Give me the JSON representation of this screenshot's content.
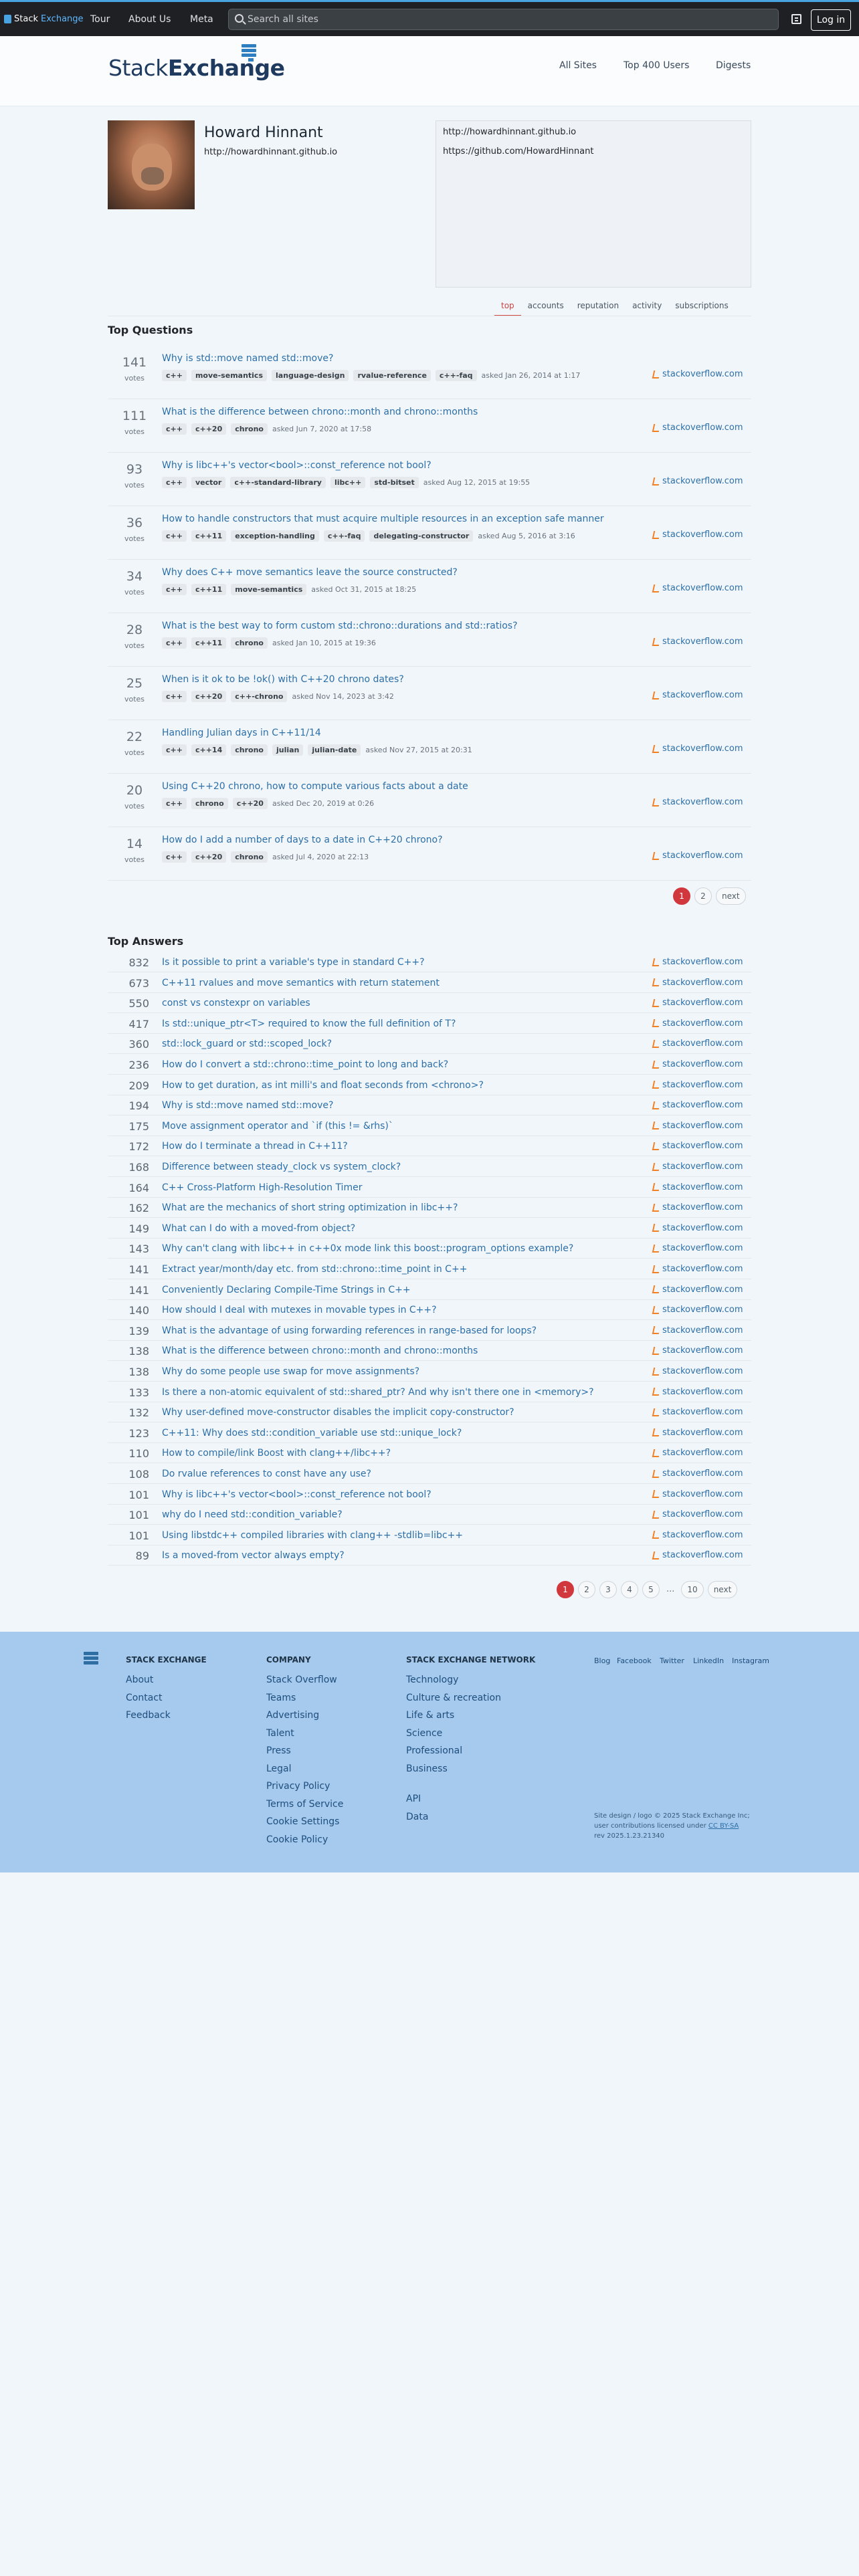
{
  "topbar": {
    "brand_stack": "Stack",
    "brand_exchange": "Exchange",
    "nav": [
      "Tour",
      "About Us",
      "Meta"
    ],
    "search_placeholder": "Search all sites",
    "login": "Log in"
  },
  "header": {
    "logo_stack": "Stack",
    "logo_exchange": "Exchange",
    "nav": [
      "All Sites",
      "Top 400 Users",
      "Digests"
    ]
  },
  "profile": {
    "name": "Howard Hinnant",
    "url": "http://howardhinnant.github.io",
    "about": [
      "http://howardhinnant.github.io",
      "https://github.com/HowardHinnant"
    ],
    "tabs": [
      "top",
      "accounts",
      "reputation",
      "activity",
      "subscriptions"
    ],
    "active_tab": "top"
  },
  "top_questions": {
    "heading": "Top Questions",
    "votes_label": "votes",
    "items": [
      {
        "votes": "141",
        "title": "Why is std::move named std::move?",
        "tags": [
          "c++",
          "move-semantics",
          "language-design",
          "rvalue-reference",
          "c++-faq"
        ],
        "asked": "asked Jan 26, 2014 at 1:17",
        "site": "stackoverflow.com"
      },
      {
        "votes": "111",
        "title": "What is the difference between chrono::month and chrono::months",
        "tags": [
          "c++",
          "c++20",
          "chrono"
        ],
        "asked": "asked Jun 7, 2020 at 17:58",
        "site": "stackoverflow.com"
      },
      {
        "votes": "93",
        "title": "Why is libc++'s vector<bool>::const_reference not bool?",
        "tags": [
          "c++",
          "vector",
          "c++-standard-library",
          "libc++",
          "std-bitset"
        ],
        "asked": "asked Aug 12, 2015 at 19:55",
        "site": "stackoverflow.com"
      },
      {
        "votes": "36",
        "title": "How to handle constructors that must acquire multiple resources in an exception safe manner",
        "tags": [
          "c++",
          "c++11",
          "exception-handling",
          "c++-faq",
          "delegating-constructor"
        ],
        "asked": "asked Aug 5, 2016 at 3:16",
        "site": "stackoverflow.com"
      },
      {
        "votes": "34",
        "title": "Why does C++ move semantics leave the source constructed?",
        "tags": [
          "c++",
          "c++11",
          "move-semantics"
        ],
        "asked": "asked Oct 31, 2015 at 18:25",
        "site": "stackoverflow.com"
      },
      {
        "votes": "28",
        "title": "What is the best way to form custom std::chrono::durations and std::ratios?",
        "tags": [
          "c++",
          "c++11",
          "chrono"
        ],
        "asked": "asked Jan 10, 2015 at 19:36",
        "site": "stackoverflow.com"
      },
      {
        "votes": "25",
        "title": "When is it ok to be !ok() with C++20 chrono dates?",
        "tags": [
          "c++",
          "c++20",
          "c++-chrono"
        ],
        "asked": "asked Nov 14, 2023 at 3:42",
        "site": "stackoverflow.com"
      },
      {
        "votes": "22",
        "title": "Handling Julian days in C++11/14",
        "tags": [
          "c++",
          "c++14",
          "chrono",
          "julian",
          "julian-date"
        ],
        "asked": "asked Nov 27, 2015 at 20:31",
        "site": "stackoverflow.com"
      },
      {
        "votes": "20",
        "title": "Using C++20 chrono, how to compute various facts about a date",
        "tags": [
          "c++",
          "chrono",
          "c++20"
        ],
        "asked": "asked Dec 20, 2019 at 0:26",
        "site": "stackoverflow.com"
      },
      {
        "votes": "14",
        "title": "How do I add a number of days to a date in C++20 chrono?",
        "tags": [
          "c++",
          "c++20",
          "chrono"
        ],
        "asked": "asked Jul 4, 2020 at 22:13",
        "site": "stackoverflow.com"
      }
    ],
    "pages": [
      "1",
      "2"
    ],
    "next": "next"
  },
  "top_answers": {
    "heading": "Top Answers",
    "items": [
      {
        "votes": "832",
        "title": "Is it possible to print a variable's type in standard C++?",
        "site": "stackoverflow.com"
      },
      {
        "votes": "673",
        "title": "C++11 rvalues and move semantics with return statement",
        "site": "stackoverflow.com"
      },
      {
        "votes": "550",
        "title": "const vs constexpr on variables",
        "site": "stackoverflow.com"
      },
      {
        "votes": "417",
        "title": "Is std::unique_ptr<T> required to know the full definition of T?",
        "site": "stackoverflow.com"
      },
      {
        "votes": "360",
        "title": "std::lock_guard or std::scoped_lock?",
        "site": "stackoverflow.com"
      },
      {
        "votes": "236",
        "title": "How do I convert a std::chrono::time_point to long and back?",
        "site": "stackoverflow.com"
      },
      {
        "votes": "209",
        "title": "How to get duration, as int milli's and float seconds from <chrono>?",
        "site": "stackoverflow.com"
      },
      {
        "votes": "194",
        "title": "Why is std::move named std::move?",
        "site": "stackoverflow.com"
      },
      {
        "votes": "175",
        "title": "Move assignment operator and `if (this != &rhs)`",
        "site": "stackoverflow.com"
      },
      {
        "votes": "172",
        "title": "How do I terminate a thread in C++11?",
        "site": "stackoverflow.com"
      },
      {
        "votes": "168",
        "title": "Difference between steady_clock vs system_clock?",
        "site": "stackoverflow.com"
      },
      {
        "votes": "164",
        "title": "C++ Cross-Platform High-Resolution Timer",
        "site": "stackoverflow.com"
      },
      {
        "votes": "162",
        "title": "What are the mechanics of short string optimization in libc++?",
        "site": "stackoverflow.com"
      },
      {
        "votes": "149",
        "title": "What can I do with a moved-from object?",
        "site": "stackoverflow.com"
      },
      {
        "votes": "143",
        "title": "Why can't clang with libc++ in c++0x mode link this boost::program_options example?",
        "site": "stackoverflow.com"
      },
      {
        "votes": "141",
        "title": "Extract year/month/day etc. from std::chrono::time_point in C++",
        "site": "stackoverflow.com"
      },
      {
        "votes": "141",
        "title": "Conveniently Declaring Compile-Time Strings in C++",
        "site": "stackoverflow.com"
      },
      {
        "votes": "140",
        "title": "How should I deal with mutexes in movable types in C++?",
        "site": "stackoverflow.com"
      },
      {
        "votes": "139",
        "title": "What is the advantage of using forwarding references in range-based for loops?",
        "site": "stackoverflow.com"
      },
      {
        "votes": "138",
        "title": "What is the difference between chrono::month and chrono::months",
        "site": "stackoverflow.com"
      },
      {
        "votes": "138",
        "title": "Why do some people use swap for move assignments?",
        "site": "stackoverflow.com"
      },
      {
        "votes": "133",
        "title": "Is there a non-atomic equivalent of std::shared_ptr? And why isn't there one in <memory>?",
        "site": "stackoverflow.com"
      },
      {
        "votes": "132",
        "title": "Why user-defined move-constructor disables the implicit copy-constructor?",
        "site": "stackoverflow.com"
      },
      {
        "votes": "123",
        "title": "C++11: Why does std::condition_variable use std::unique_lock?",
        "site": "stackoverflow.com"
      },
      {
        "votes": "110",
        "title": "How to compile/link Boost with clang++/libc++?",
        "site": "stackoverflow.com"
      },
      {
        "votes": "108",
        "title": "Do rvalue references to const have any use?",
        "site": "stackoverflow.com"
      },
      {
        "votes": "101",
        "title": "Why is libc++'s vector<bool>::const_reference not bool?",
        "site": "stackoverflow.com"
      },
      {
        "votes": "101",
        "title": "why do I need std::condition_variable?",
        "site": "stackoverflow.com"
      },
      {
        "votes": "101",
        "title": "Using libstdc++ compiled libraries with clang++ -stdlib=libc++",
        "site": "stackoverflow.com"
      },
      {
        "votes": "89",
        "title": "Is a moved-from vector always empty?",
        "site": "stackoverflow.com"
      }
    ],
    "pages": [
      "1",
      "2",
      "3",
      "4",
      "5"
    ],
    "dots": "...",
    "last_page": "10",
    "next": "next"
  },
  "footer": {
    "stack_exchange": {
      "heading": "STACK EXCHANGE",
      "links": [
        "About",
        "Contact",
        "Feedback"
      ]
    },
    "company": {
      "heading": "COMPANY",
      "links": [
        "Stack Overflow",
        "Teams",
        "Advertising",
        "Talent",
        "Press",
        "Legal",
        "Privacy Policy",
        "Terms of Service",
        "Cookie Settings",
        "Cookie Policy"
      ]
    },
    "network": {
      "heading": "STACK EXCHANGE NETWORK",
      "links": [
        "Technology",
        "Culture & recreation",
        "Life & arts",
        "Science",
        "Professional",
        "Business"
      ],
      "links2": [
        "API",
        "Data"
      ]
    },
    "social": [
      "Blog",
      "Facebook",
      "Twitter",
      "LinkedIn",
      "Instagram"
    ],
    "copyright": [
      "Site design / logo © 2025 Stack Exchange Inc;",
      "user contributions licensed under",
      "CC BY-SA",
      "rev 2025.1.23.21340"
    ]
  },
  "colors": {
    "accent": "#d1383d",
    "link": "#2d6fa7",
    "footer_bg": "#a6c9ee",
    "topbar": "#1e2023"
  }
}
